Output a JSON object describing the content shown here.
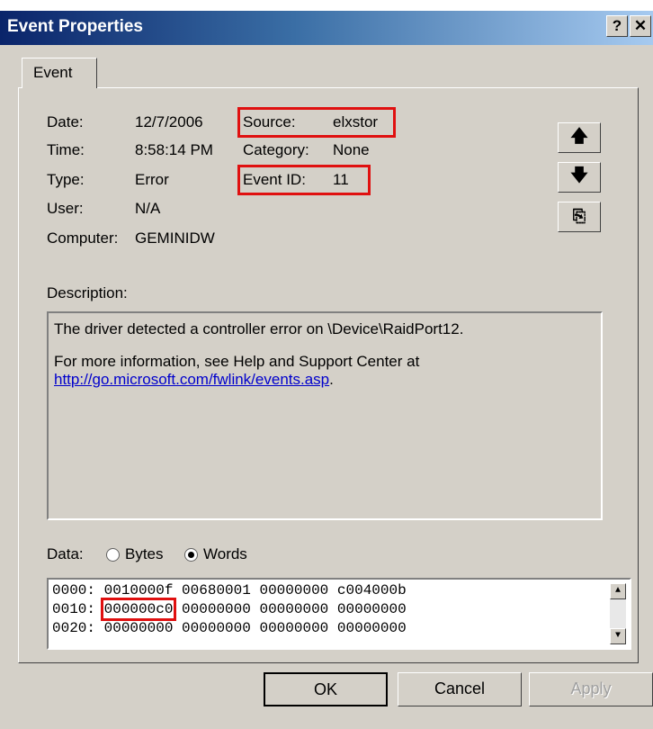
{
  "window": {
    "title": "Event Properties",
    "help_label": "?",
    "close_label": "✕"
  },
  "tabs": [
    {
      "label": "Event"
    }
  ],
  "fields": {
    "date_label": "Date:",
    "date_value": "12/7/2006",
    "time_label": "Time:",
    "time_value": "8:58:14 PM",
    "type_label": "Type:",
    "type_value": "Error",
    "user_label": "User:",
    "user_value": "N/A",
    "computer_label": "Computer:",
    "computer_value": "GEMINIDW",
    "source_label": "Source:",
    "source_value": "elxstor",
    "category_label": "Category:",
    "category_value": "None",
    "eventid_label": "Event ID:",
    "eventid_value": "11"
  },
  "side_buttons": {
    "prev_icon": "up-arrow-icon",
    "prev_glyph": "🡅",
    "next_icon": "down-arrow-icon",
    "next_glyph": "🡇",
    "copy_icon": "copy-icon",
    "copy_glyph": "⎘"
  },
  "description": {
    "label": "Description:",
    "line1": "The driver detected a controller error on \\Device\\RaidPort12.",
    "line2": "For more information, see Help and Support Center at",
    "link": "http://go.microsoft.com/fwlink/events.asp",
    "link_suffix": "."
  },
  "data_section": {
    "label": "Data:",
    "bytes_label": "Bytes",
    "words_label": "Words",
    "selected": "Words",
    "rows": [
      {
        "offset": "0000:",
        "words": [
          "0010000f",
          "00680001",
          "00000000",
          "c004000b"
        ]
      },
      {
        "offset": "0010:",
        "words": [
          "000000c0",
          "00000000",
          "00000000",
          "00000000"
        ]
      },
      {
        "offset": "0020:",
        "words": [
          "00000000",
          "00000000",
          "00000000",
          "00000000"
        ]
      }
    ]
  },
  "buttons": {
    "ok": "OK",
    "cancel": "Cancel",
    "apply": "Apply"
  },
  "colors": {
    "highlight": "#e01010",
    "link": "#0000cc",
    "titlebar": "#0a246a"
  }
}
